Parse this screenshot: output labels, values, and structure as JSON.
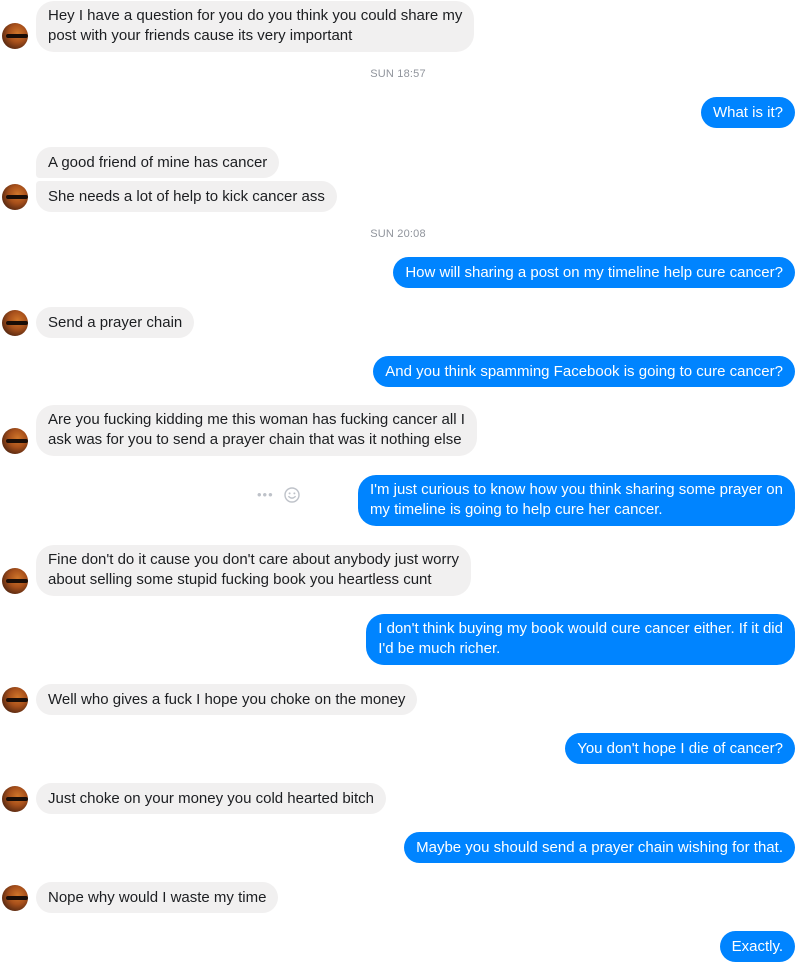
{
  "timestamps": [
    "SUN 18:57",
    "SUN 20:08"
  ],
  "messages": [
    {
      "from": "them",
      "text": "Hey I have a question for you do you think you could share my\npost with your friends cause its very important"
    },
    {
      "from": "me",
      "text": "What is it?"
    },
    {
      "from": "them",
      "text": "A good friend of mine has cancer"
    },
    {
      "from": "them",
      "text": "She needs a lot of help to kick cancer ass"
    },
    {
      "from": "me",
      "text": "How will sharing a post on my timeline help cure cancer?"
    },
    {
      "from": "them",
      "text": "Send a prayer chain"
    },
    {
      "from": "me",
      "text": "And you think spamming Facebook is going to cure cancer?"
    },
    {
      "from": "them",
      "text": "Are you fucking kidding me this woman has fucking cancer all I\nask was for you to send a prayer chain that was it nothing else"
    },
    {
      "from": "me",
      "text": "I'm just curious to know how you think sharing some prayer on\nmy timeline is going to help cure her cancer."
    },
    {
      "from": "them",
      "text": "Fine don't do it cause you don't care about anybody just worry\nabout selling some stupid fucking book you heartless cunt"
    },
    {
      "from": "me",
      "text": "I don't think buying my book would cure cancer either. If it did\nI'd be much richer."
    },
    {
      "from": "them",
      "text": "Well who gives a fuck I hope you choke on the money"
    },
    {
      "from": "me",
      "text": "You don't hope I die of cancer?"
    },
    {
      "from": "them",
      "text": "Just choke on your money you cold hearted bitch"
    },
    {
      "from": "me",
      "text": "Maybe you should send a prayer chain wishing for that."
    },
    {
      "from": "them",
      "text": "Nope why would I waste my time"
    },
    {
      "from": "me",
      "text": "Exactly."
    }
  ],
  "message_actions": {
    "more_icon": "ellipsis-icon",
    "react_icon": "smiley-icon"
  },
  "colors": {
    "incoming_bg": "#f1f0f0",
    "outgoing_bg": "#0084ff",
    "timestamp": "#90949c"
  }
}
